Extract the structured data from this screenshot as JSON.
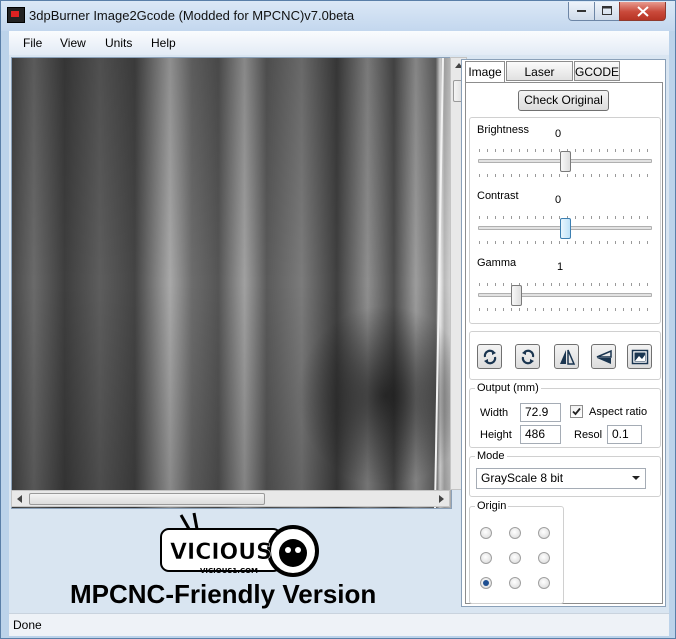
{
  "window": {
    "title": "3dpBurner Image2Gcode (Modded for MPCNC)v7.0beta"
  },
  "menu": {
    "file": "File",
    "view": "View",
    "units": "Units",
    "help": "Help"
  },
  "tabs": {
    "image": "Image",
    "laser_profile": "Laser profile",
    "gcode": "GCODE"
  },
  "image_tab": {
    "check_original": "Check Original",
    "brightness": {
      "label": "Brightness",
      "value": "0",
      "level": 0.5
    },
    "contrast": {
      "label": "Contrast",
      "value": "0",
      "level": 0.5
    },
    "gamma": {
      "label": "Gamma",
      "value": "1",
      "level": 0.2
    },
    "tools": [
      "rotate-left-icon",
      "rotate-right-icon",
      "flip-horizontal-icon",
      "flip-vertical-icon",
      "invert-image-icon"
    ],
    "output": {
      "title": "Output (mm)",
      "width_label": "Width",
      "width_value": "72.9",
      "aspect_ratio_label": "Aspect ratio",
      "aspect_ratio_checked": true,
      "height_label": "Height",
      "height_value": "486",
      "resol_label": "Resol",
      "resol_value": "0.1"
    },
    "mode": {
      "title": "Mode",
      "selected": "GrayScale 8 bit"
    },
    "origin": {
      "title": "Origin",
      "selected_index": 6
    }
  },
  "logo": {
    "brand_text": "MPCNC-Friendly Version",
    "logo_text": "VICIOUS",
    "logo_url_text": "VICIOUS1.COM"
  },
  "status": {
    "text": "Done"
  },
  "colors": {
    "frame": "#bcd3ea",
    "client": "#d9e5f1",
    "close_red": "#c9493a"
  }
}
